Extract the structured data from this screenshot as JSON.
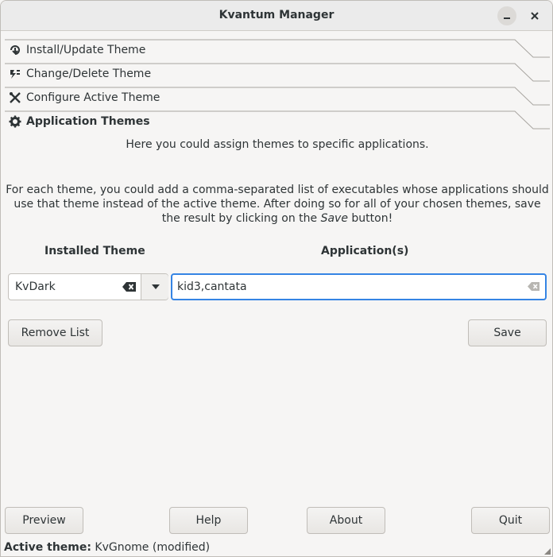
{
  "window": {
    "title": "Kvantum Manager"
  },
  "sections": [
    {
      "label": "Install/Update Theme",
      "icon": "install-icon"
    },
    {
      "label": "Change/Delete Theme",
      "icon": "change-icon"
    },
    {
      "label": "Configure Active Theme",
      "icon": "tools-icon"
    },
    {
      "label": "Application Themes",
      "icon": "gear-icon"
    }
  ],
  "app_themes": {
    "intro": "Here you could assign themes to specific applications.",
    "description_before": "For each theme, you could add a comma-separated list of executables whose applications should use that theme instead of the active theme. After doing so for all of your chosen themes, save the result by clicking on the ",
    "description_em": "Save",
    "description_after": " button!",
    "col_installed": "Installed Theme",
    "col_apps": "Application(s)",
    "selected_theme": "KvDark",
    "apps_value": "kid3,cantata",
    "remove_label": "Remove List",
    "save_label": "Save"
  },
  "footer": {
    "preview": "Preview",
    "help": "Help",
    "about": "About",
    "quit": "Quit"
  },
  "status": {
    "label": "Active theme:",
    "value": " KvGnome (modified)"
  },
  "colors": {
    "accent": "#3584e4",
    "window_bg": "#f6f5f4"
  }
}
